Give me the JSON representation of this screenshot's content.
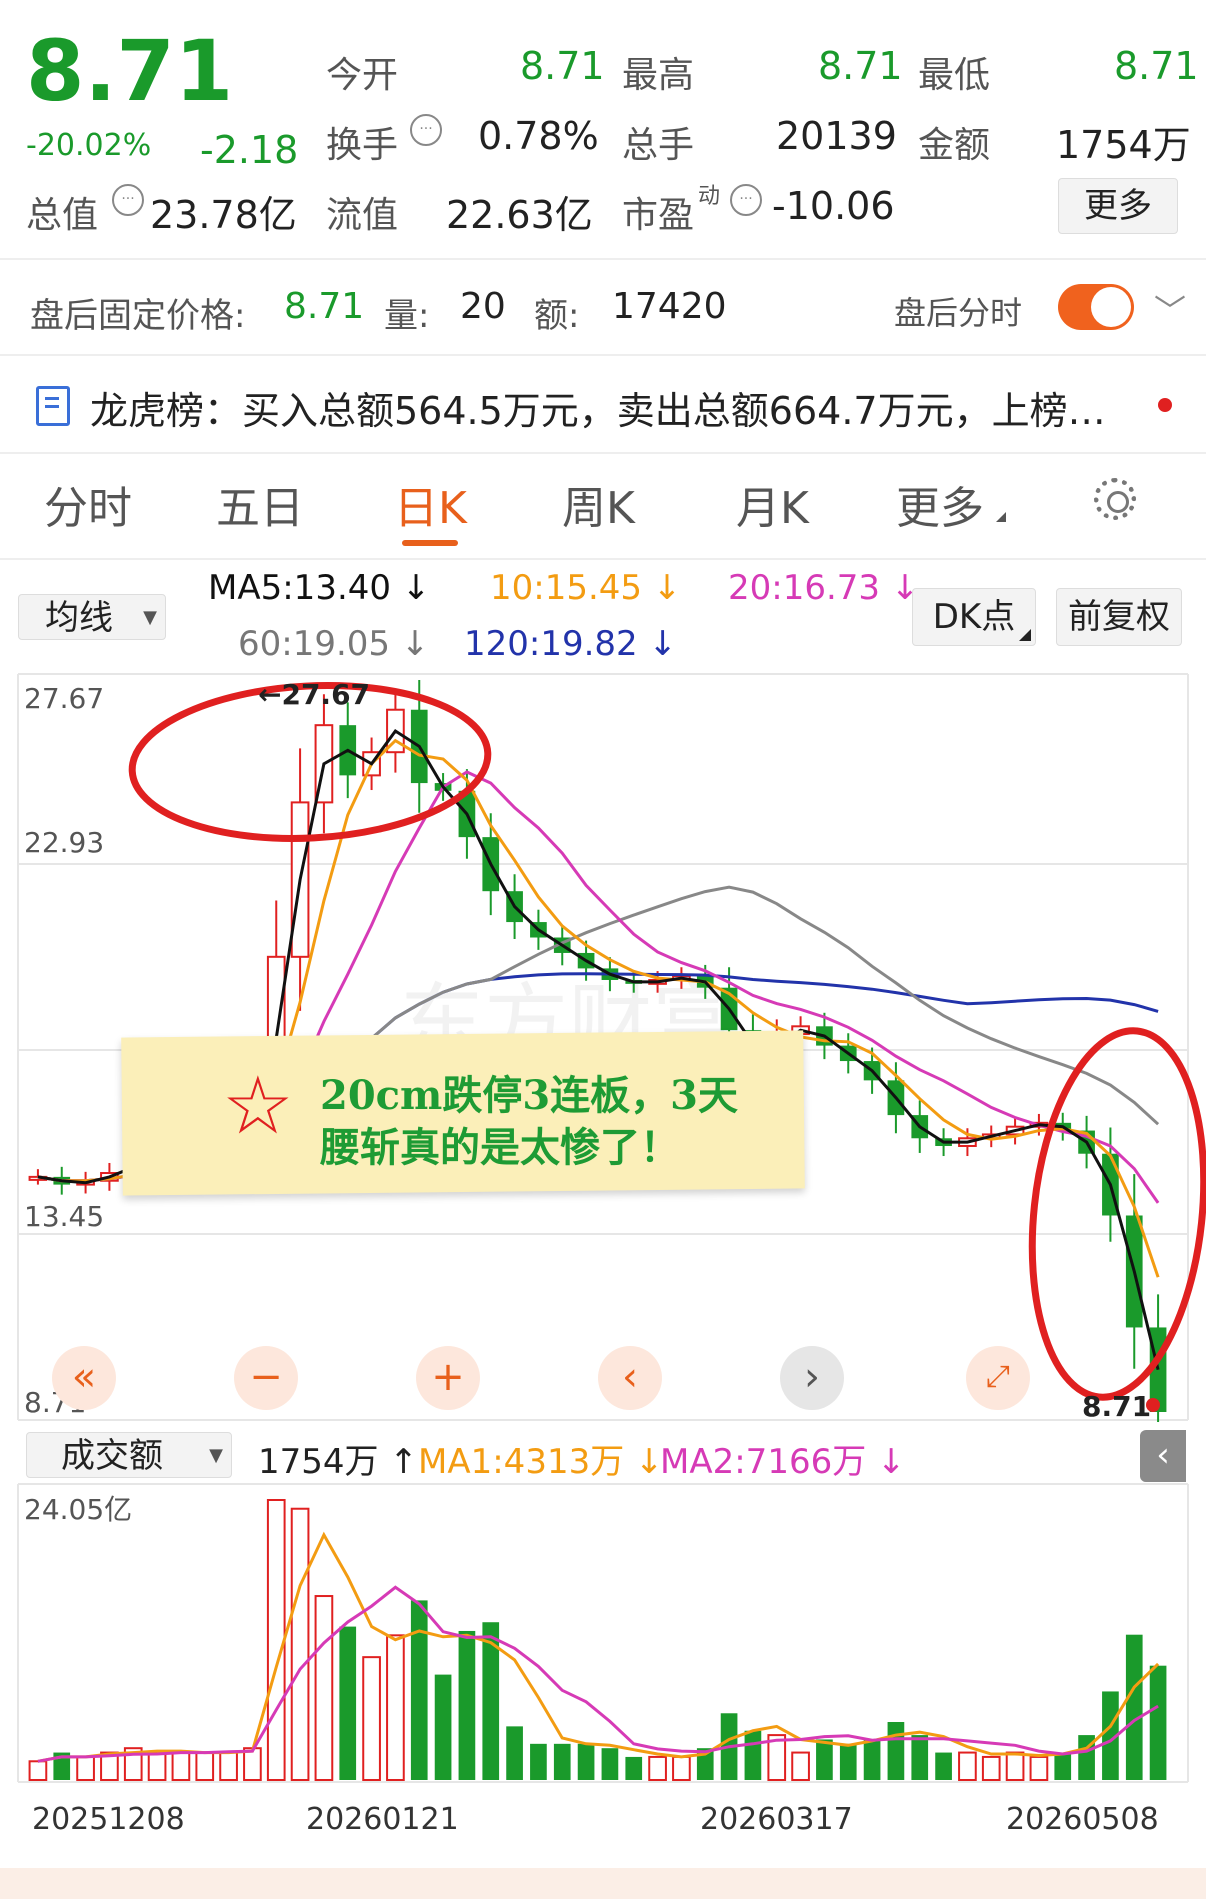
{
  "quote": {
    "price": "8.71",
    "change_pct": "-20.02%",
    "change_abs": "-2.18",
    "fields": [
      {
        "label": "今开",
        "value": "8.71"
      },
      {
        "label": "最高",
        "value": "8.71"
      },
      {
        "label": "最低",
        "value": "8.71"
      },
      {
        "label": "换手",
        "value": "0.78%"
      },
      {
        "label": "总手",
        "value": "20139"
      },
      {
        "label": "金额",
        "value": "1754万"
      },
      {
        "label": "总值",
        "value": "23.78亿"
      },
      {
        "label": "流值",
        "value": "22.63亿"
      },
      {
        "label": "市盈",
        "value": "-10.06"
      }
    ],
    "pe_super": "动",
    "more_button": "更多"
  },
  "after_hours": {
    "price_label": "盘后固定价格:",
    "price": "8.71",
    "volume_label": "量:",
    "volume": "20",
    "amount_label": "额:",
    "amount": "17420",
    "toggle_label": "盘后分时",
    "toggle_on": true
  },
  "dragon_tiger": {
    "text": "龙虎榜：买入总额564.5万元，卖出总额664.7万元，上榜…"
  },
  "tabs": [
    "分时",
    "五日",
    "日K",
    "周K",
    "月K",
    "更多"
  ],
  "active_tab": "日K",
  "ma": {
    "selector": "均线",
    "ma5": "MA5:13.40 ↓",
    "ma10": "10:15.45 ↓",
    "ma20": "20:16.73 ↓",
    "ma60": "60:19.05 ↓",
    "ma120": "120:19.82 ↓",
    "dk_button": "DK点",
    "adjust_button": "前复权"
  },
  "colors": {
    "up": "#e02020",
    "down": "#1a9a2b",
    "ma5": "#111111",
    "ma10": "#f39c12",
    "ma20": "#d63ab6",
    "ma60": "#888888",
    "ma120": "#2233aa",
    "accent": "#e8601c"
  },
  "price_axis": [
    "27.67",
    "22.93",
    "13.45",
    "8.71"
  ],
  "high_marker": "27.67",
  "last_marker": "8.71",
  "annotation": {
    "line1": "20cm跌停3连板，3天",
    "line2": "腰斩真的是太惨了！"
  },
  "volume": {
    "selector": "成交额",
    "current": "1754万 ↑",
    "ma1": "MA1:4313万 ↓",
    "ma2": "MA2:7166万 ↓",
    "max_label": "24.05亿"
  },
  "dates": [
    "20251208",
    "20260121",
    "20260317",
    "20260508"
  ],
  "nav_icons": [
    "double-left-icon",
    "zoom-out-icon",
    "zoom-in-icon",
    "left-icon",
    "right-icon",
    "expand-icon"
  ],
  "chart_data": {
    "type": "candlestick",
    "x": [
      "20251208",
      "20260121",
      "20260317",
      "20260508"
    ],
    "price_close_approx": [
      14.8,
      14.6,
      14.7,
      14.9,
      15.2,
      15.4,
      15.6,
      15.8,
      16.0,
      16.3,
      20.5,
      24.5,
      26.5,
      25.2,
      25.8,
      26.9,
      25.0,
      24.8,
      23.6,
      22.2,
      21.4,
      21.0,
      20.6,
      20.2,
      19.9,
      19.8,
      19.9,
      20.0,
      19.7,
      18.6,
      17.9,
      18.5,
      18.7,
      18.2,
      17.8,
      17.3,
      16.4,
      15.8,
      15.6,
      15.8,
      15.9,
      16.1,
      16.2,
      16.0,
      15.4,
      13.8,
      10.9,
      8.71
    ],
    "ylim": [
      8.71,
      27.67
    ],
    "yticks": [
      27.67,
      22.93,
      13.45,
      8.71
    ],
    "ma_values": {
      "MA5": 13.4,
      "MA10": 15.45,
      "MA20": 16.73,
      "MA60": 19.05,
      "MA120": 19.82
    }
  }
}
